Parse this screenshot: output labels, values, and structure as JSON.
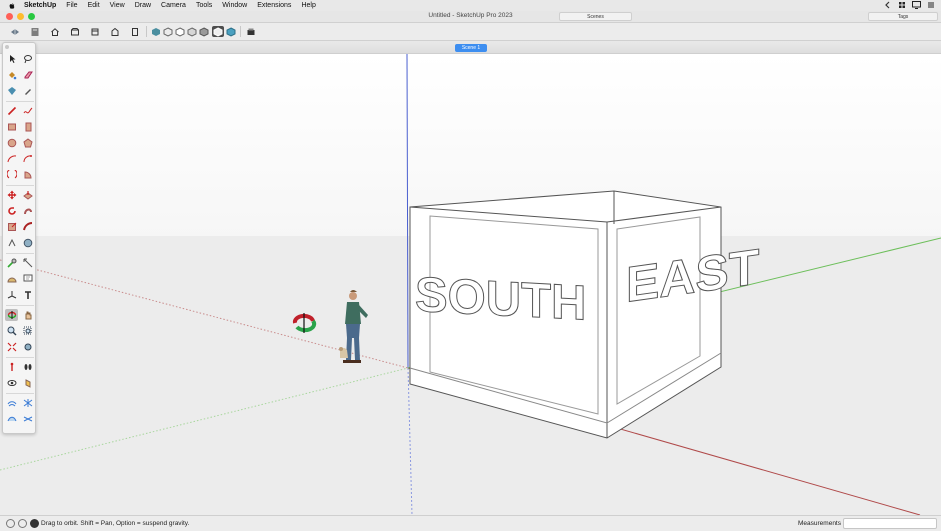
{
  "menubar": {
    "app_name": "SketchUp",
    "items": [
      "File",
      "Edit",
      "View",
      "Draw",
      "Camera",
      "Tools",
      "Window",
      "Extensions",
      "Help"
    ]
  },
  "window": {
    "title": "Untitled - SketchUp Pro 2023",
    "panels": {
      "scenes": "Scenes",
      "tags": "Tags"
    }
  },
  "scenes": {
    "active_tab": "Scene 1"
  },
  "model": {
    "face_south": "SOUTH",
    "face_east": "EAST"
  },
  "status": {
    "hint": "Drag to orbit. Shift = Pan, Option = suspend gravity.",
    "measurements_label": "Measurements",
    "measurements_value": ""
  },
  "colors": {
    "blue_axis": "#4a5fd0",
    "red_axis": "#b04a4a",
    "green_axis": "#6dbf5b",
    "scene_tab": "#3d8ef0"
  }
}
